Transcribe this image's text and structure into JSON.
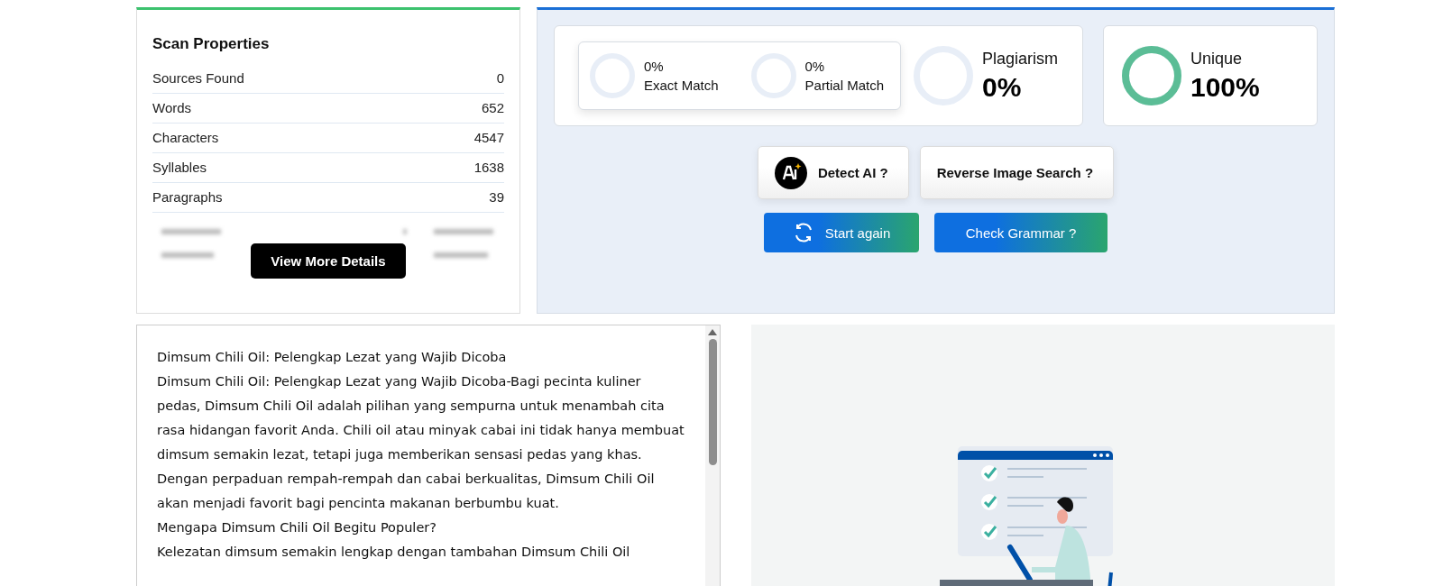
{
  "scan_properties": {
    "title": "Scan Properties",
    "rows": [
      {
        "label": "Sources Found",
        "value": "0"
      },
      {
        "label": "Words",
        "value": "652"
      },
      {
        "label": "Characters",
        "value": "4547"
      },
      {
        "label": "Syllables",
        "value": "1638"
      },
      {
        "label": "Paragraphs",
        "value": "39"
      }
    ],
    "button": "View More Details"
  },
  "results": {
    "matches": [
      {
        "value": "0%",
        "label": "Exact Match",
        "level": 0
      },
      {
        "value": "0%",
        "label": "Partial Match",
        "level": 0
      }
    ],
    "plagiarism": {
      "label": "Plagiarism",
      "value": "0%",
      "level": 0
    },
    "unique": {
      "label": "Unique",
      "value": "100%",
      "level": 1
    },
    "tools": [
      {
        "label": "Detect AI ?",
        "kind": "ai"
      },
      {
        "label": "Reverse Image Search ?",
        "kind": "plain"
      }
    ],
    "actions": [
      {
        "label": "Start again",
        "kind": "refresh"
      },
      {
        "label": "Check Grammar ?",
        "kind": "plain"
      }
    ]
  },
  "document": {
    "lines": [
      "Dimsum Chili Oil: Pelengkap Lezat yang Wajib Dicoba",
      "Dimsum Chili Oil: Pelengkap Lezat yang Wajib Dicoba-Bagi pecinta kuliner pedas, Dimsum Chili Oil adalah pilihan yang sempurna untuk menambah cita rasa hidangan favorit Anda. Chili oil atau minyak cabai ini tidak hanya membuat dimsum semakin lezat, tetapi juga memberikan sensasi pedas yang khas. Dengan perpaduan rempah-rempah dan cabai berkualitas, Dimsum Chili Oil akan menjadi favorit bagi pencinta makanan berbumbu kuat.",
      "Mengapa Dimsum Chili Oil Begitu Populer?",
      "Kelezatan dimsum semakin lengkap dengan tambahan Dimsum Chili Oil"
    ]
  }
}
